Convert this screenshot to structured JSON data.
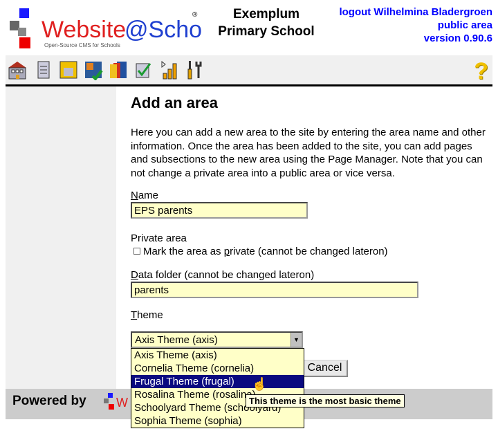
{
  "header": {
    "logo_text": "Website@School",
    "logo_tagline": "Open-Source CMS for Schools",
    "school_line1": "Exemplum",
    "school_line2": "Primary School",
    "logout": "logout Wilhelmina Bladergroen",
    "area": "public area",
    "version": "version 0.90.6"
  },
  "toolbar": {
    "icons": [
      "home-icon",
      "page-icon",
      "floppy-icon",
      "puzzle-icon",
      "faces-icon",
      "checklist-icon",
      "chart-icon",
      "tools-icon"
    ],
    "help": "?"
  },
  "main": {
    "title": "Add an area",
    "intro": "Here you can add a new area to the site by entering the area name and other information. Once the area has been added to the site, you can add pages and subsections to the new area using the Page Manager. Note that you can not change a private area into a public area or vice versa.",
    "name_label_key": "N",
    "name_label_rest": "ame",
    "name_value": "EPS parents",
    "private_label": "Private area",
    "private_check_pre": "Mark the area as ",
    "private_check_key": "p",
    "private_check_post": "rivate (cannot be changed lateron)",
    "private_checked": false,
    "folder_label_key": "D",
    "folder_label_rest": "ata folder (cannot be changed lateron)",
    "folder_value": "parents",
    "theme_label_key": "T",
    "theme_label_rest": "heme",
    "theme_selected": "Axis Theme (axis)",
    "theme_options": [
      "Axis Theme (axis)",
      "Cornelia Theme (cornelia)",
      "Frugal Theme (frugal)",
      "Rosalina Theme (rosalina)",
      "Schoolyard Theme (schoolyard)",
      "Sophia Theme (sophia)"
    ],
    "highlighted_index": 2,
    "tooltip": "This theme is the most basic theme",
    "cancel": "Cancel"
  },
  "footer": {
    "powered": "Powered by"
  },
  "colors": {
    "link": "#0000ff",
    "highlight": "#0a0a80",
    "field": "#ffffc8"
  }
}
